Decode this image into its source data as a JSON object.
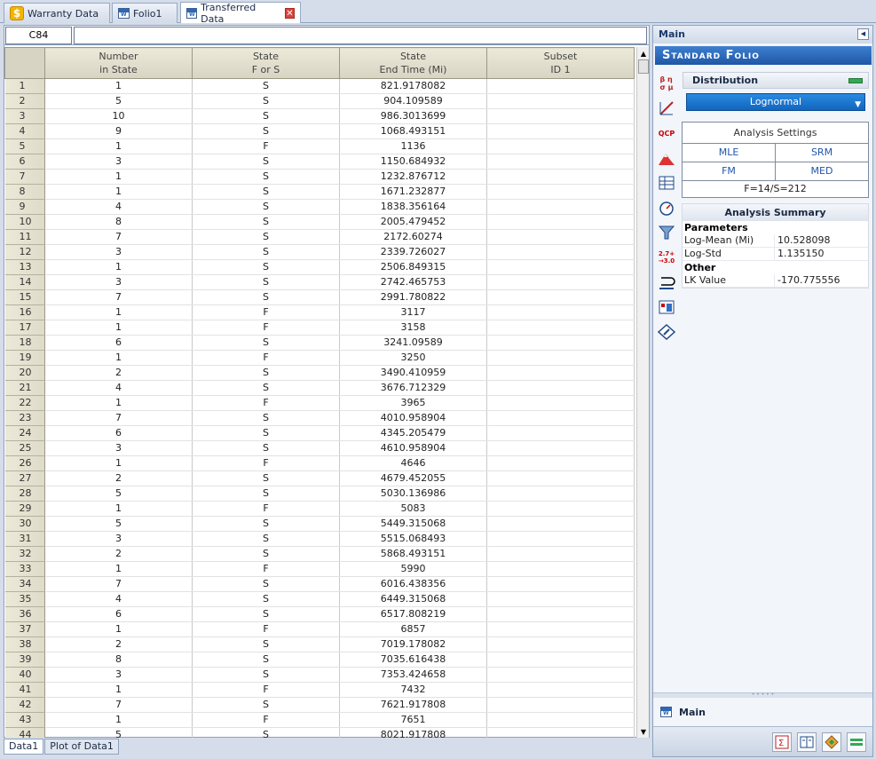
{
  "tabs": [
    {
      "label": "Warranty Data",
      "icon": "dollar-icon"
    },
    {
      "label": "Folio1",
      "icon": "folio-icon"
    },
    {
      "label": "Transferred Data",
      "icon": "folio-icon",
      "active": true
    }
  ],
  "formula": {
    "cell_ref": "C84",
    "value": ""
  },
  "columns": [
    {
      "line1": "Number",
      "line2": "in State"
    },
    {
      "line1": "State",
      "line2": "F or S"
    },
    {
      "line1": "State",
      "line2": "End Time (Mi)"
    },
    {
      "line1": "Subset",
      "line2": "ID 1"
    }
  ],
  "rows": [
    {
      "n": "1",
      "num": "1",
      "fs": "S",
      "time": "821.9178082"
    },
    {
      "n": "2",
      "num": "5",
      "fs": "S",
      "time": "904.109589"
    },
    {
      "n": "3",
      "num": "10",
      "fs": "S",
      "time": "986.3013699"
    },
    {
      "n": "4",
      "num": "9",
      "fs": "S",
      "time": "1068.493151"
    },
    {
      "n": "5",
      "num": "1",
      "fs": "F",
      "time": "1136"
    },
    {
      "n": "6",
      "num": "3",
      "fs": "S",
      "time": "1150.684932"
    },
    {
      "n": "7",
      "num": "1",
      "fs": "S",
      "time": "1232.876712"
    },
    {
      "n": "8",
      "num": "1",
      "fs": "S",
      "time": "1671.232877"
    },
    {
      "n": "9",
      "num": "4",
      "fs": "S",
      "time": "1838.356164"
    },
    {
      "n": "10",
      "num": "8",
      "fs": "S",
      "time": "2005.479452"
    },
    {
      "n": "11",
      "num": "7",
      "fs": "S",
      "time": "2172.60274"
    },
    {
      "n": "12",
      "num": "3",
      "fs": "S",
      "time": "2339.726027"
    },
    {
      "n": "13",
      "num": "1",
      "fs": "S",
      "time": "2506.849315"
    },
    {
      "n": "14",
      "num": "3",
      "fs": "S",
      "time": "2742.465753"
    },
    {
      "n": "15",
      "num": "7",
      "fs": "S",
      "time": "2991.780822"
    },
    {
      "n": "16",
      "num": "1",
      "fs": "F",
      "time": "3117"
    },
    {
      "n": "17",
      "num": "1",
      "fs": "F",
      "time": "3158"
    },
    {
      "n": "18",
      "num": "6",
      "fs": "S",
      "time": "3241.09589"
    },
    {
      "n": "19",
      "num": "1",
      "fs": "F",
      "time": "3250"
    },
    {
      "n": "20",
      "num": "2",
      "fs": "S",
      "time": "3490.410959"
    },
    {
      "n": "21",
      "num": "4",
      "fs": "S",
      "time": "3676.712329"
    },
    {
      "n": "22",
      "num": "1",
      "fs": "F",
      "time": "3965"
    },
    {
      "n": "23",
      "num": "7",
      "fs": "S",
      "time": "4010.958904"
    },
    {
      "n": "24",
      "num": "6",
      "fs": "S",
      "time": "4345.205479"
    },
    {
      "n": "25",
      "num": "3",
      "fs": "S",
      "time": "4610.958904"
    },
    {
      "n": "26",
      "num": "1",
      "fs": "F",
      "time": "4646"
    },
    {
      "n": "27",
      "num": "2",
      "fs": "S",
      "time": "4679.452055"
    },
    {
      "n": "28",
      "num": "5",
      "fs": "S",
      "time": "5030.136986"
    },
    {
      "n": "29",
      "num": "1",
      "fs": "F",
      "time": "5083"
    },
    {
      "n": "30",
      "num": "5",
      "fs": "S",
      "time": "5449.315068"
    },
    {
      "n": "31",
      "num": "3",
      "fs": "S",
      "time": "5515.068493"
    },
    {
      "n": "32",
      "num": "2",
      "fs": "S",
      "time": "5868.493151"
    },
    {
      "n": "33",
      "num": "1",
      "fs": "F",
      "time": "5990"
    },
    {
      "n": "34",
      "num": "7",
      "fs": "S",
      "time": "6016.438356"
    },
    {
      "n": "35",
      "num": "4",
      "fs": "S",
      "time": "6449.315068"
    },
    {
      "n": "36",
      "num": "6",
      "fs": "S",
      "time": "6517.808219"
    },
    {
      "n": "37",
      "num": "1",
      "fs": "F",
      "time": "6857"
    },
    {
      "n": "38",
      "num": "2",
      "fs": "S",
      "time": "7019.178082"
    },
    {
      "n": "39",
      "num": "8",
      "fs": "S",
      "time": "7035.616438"
    },
    {
      "n": "40",
      "num": "3",
      "fs": "S",
      "time": "7353.424658"
    },
    {
      "n": "41",
      "num": "1",
      "fs": "F",
      "time": "7432"
    },
    {
      "n": "42",
      "num": "7",
      "fs": "S",
      "time": "7621.917808"
    },
    {
      "n": "43",
      "num": "1",
      "fs": "F",
      "time": "7651"
    },
    {
      "n": "44",
      "num": "5",
      "fs": "S",
      "time": "8021.917808"
    }
  ],
  "sheet_tabs": [
    {
      "label": "Data1",
      "active": true
    },
    {
      "label": "Plot of Data1",
      "active": false
    }
  ],
  "panel": {
    "header": "Main",
    "banner": "Standard Folio",
    "distribution_label": "Distribution",
    "distribution_value": "Lognormal",
    "settings_title": "Analysis Settings",
    "methods": [
      "MLE",
      "SRM",
      "FM",
      "MED"
    ],
    "fs_summary": "F=14/S=212",
    "summary_title": "Analysis Summary",
    "parameters_label": "Parameters",
    "params": [
      {
        "k": "Log-Mean (Mi)",
        "v": "10.528098"
      },
      {
        "k": "Log-Std",
        "v": "1.135150"
      }
    ],
    "other_label": "Other",
    "others": [
      {
        "k": "LK Value",
        "v": "-170.775556"
      }
    ],
    "bottom_label": "Main"
  },
  "colors": {
    "accent": "#1f57a6",
    "banner": "#2f6fc4",
    "green": "#34a853"
  }
}
